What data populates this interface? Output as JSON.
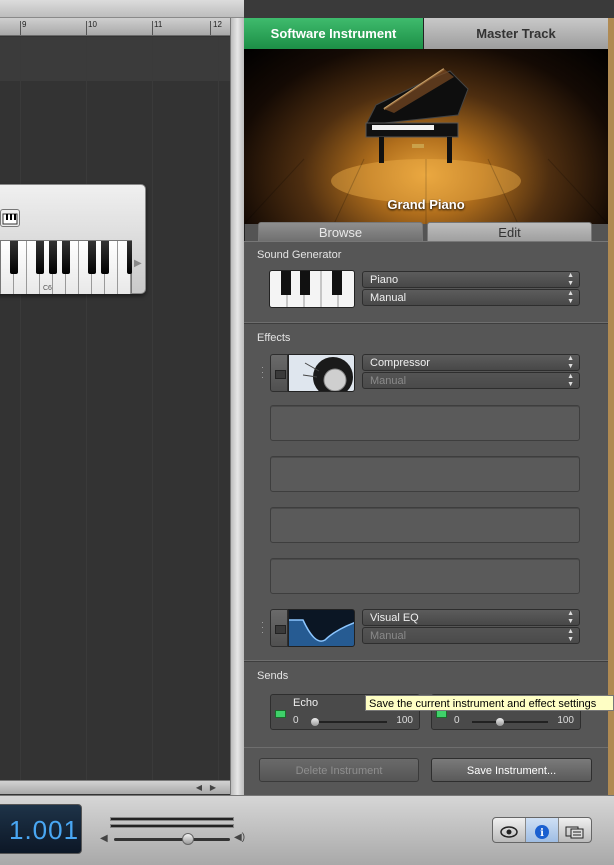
{
  "ruler": {
    "ticks": [
      "9",
      "10",
      "11",
      "12"
    ]
  },
  "keyboard": {
    "octave_label": "C6"
  },
  "panel_tabs": {
    "software_instrument": "Software Instrument",
    "master_track": "Master Track"
  },
  "instrument": {
    "name": "Grand Piano"
  },
  "sub_tabs": {
    "browse": "Browse",
    "edit": "Edit"
  },
  "sound_generator": {
    "title": "Sound Generator",
    "instrument_value": "Piano",
    "preset_value": "Manual"
  },
  "effects": {
    "title": "Effects",
    "slot1": {
      "name": "Compressor",
      "preset": "Manual"
    },
    "slot6": {
      "name": "Visual EQ",
      "preset": "Manual"
    }
  },
  "sends": {
    "title": "Sends",
    "send1": {
      "name": "Echo",
      "min": "0",
      "max": "100",
      "level": 0.0
    },
    "send2": {
      "min": "0",
      "max": "100",
      "level": 0.35
    }
  },
  "tooltip": {
    "text": "Save the current instrument and effect settings"
  },
  "buttons": {
    "delete": "Delete Instrument",
    "save": "Save Instrument..."
  },
  "transport": {
    "lcd_value": "1.001",
    "master_volume": 0.65
  },
  "colors": {
    "active_tab": "#2aa457",
    "lcd_text": "#49a7f3",
    "send_led": "#3fd16a"
  },
  "icons": [
    "eye-icon",
    "info-icon",
    "media-browser-icon",
    "speaker-low-icon",
    "speaker-high-icon"
  ]
}
